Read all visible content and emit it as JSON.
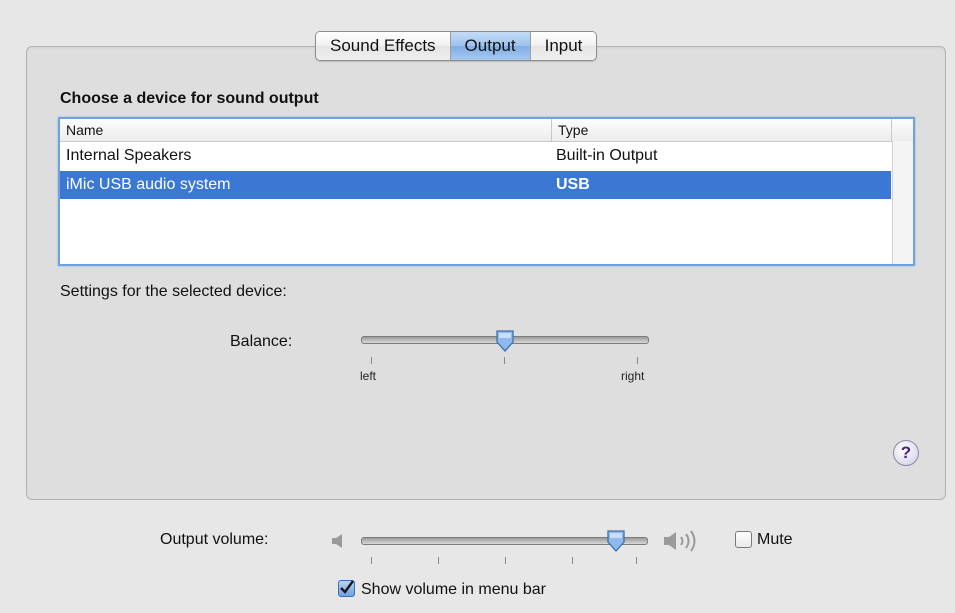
{
  "tabs": [
    {
      "label": "Sound Effects",
      "selected": false
    },
    {
      "label": "Output",
      "selected": true
    },
    {
      "label": "Input",
      "selected": false
    }
  ],
  "section_title": "Choose a device for sound output",
  "table": {
    "columns": [
      "Name",
      "Type"
    ],
    "rows": [
      {
        "name": "Internal Speakers",
        "type": "Built-in Output",
        "selected": false
      },
      {
        "name": "iMic USB audio system",
        "type": "USB",
        "selected": true
      }
    ]
  },
  "settings_label": "Settings for the selected device:",
  "balance": {
    "label": "Balance:",
    "left_label": "left",
    "right_label": "right",
    "value_fraction": 0.5
  },
  "help_label": "?",
  "output_volume": {
    "label": "Output volume:",
    "value_fraction": 0.95,
    "mute_label": "Mute",
    "muted": false
  },
  "show_volume": {
    "label": "Show volume in menu bar",
    "checked": true
  },
  "colors": {
    "selection": "#3b78d3",
    "tab_selected": "#9cc1ec",
    "help_mark": "#4a1f8a"
  }
}
